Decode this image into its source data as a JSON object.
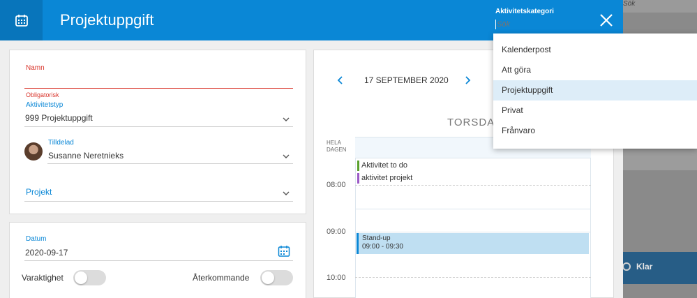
{
  "background": {
    "search_hint": "Sök",
    "done_label": "Klar"
  },
  "header": {
    "title": "Projektuppgift",
    "category_label": "Aktivitetskategori",
    "category_placeholder": "Sök"
  },
  "form": {
    "name_label": "Namn",
    "name_value": "",
    "required_hint": "Obligatorisk",
    "type_label": "Aktivitetstyp",
    "type_value": "999 Projektuppgift",
    "assigned_label": "Tilldelad",
    "assigned_value": "Susanne Neretnieks",
    "project_label": "Projekt",
    "date_label": "Datum",
    "date_value": "2020-09-17",
    "duration_label": "Varaktighet",
    "recurring_label": "Återkommande",
    "duration_on": false,
    "recurring_on": false
  },
  "calendar": {
    "date_title": "17 SEPTEMBER 2020",
    "day_name": "TORSDAG",
    "all_day_line1": "HELA",
    "all_day_line2": "DAGEN",
    "times": [
      "08:00",
      "09:00",
      "10:00"
    ],
    "allday_events": [
      {
        "title": "Aktivitet to do",
        "color": "#5aa02c"
      },
      {
        "title": "aktivitet projekt",
        "color": "#9b59c6"
      }
    ],
    "event": {
      "title": "Stand-up",
      "time": "09:00 - 09:30",
      "color": "#bfdff2"
    }
  },
  "dropdown": {
    "options": [
      "Kalenderpost",
      "Att göra",
      "Projektuppgift",
      "Privat",
      "Frånvaro"
    ],
    "selected": "Projektuppgift"
  },
  "colors": {
    "header": "#0a87d6",
    "accent": "#0a87d6",
    "required": "#d9352c"
  }
}
